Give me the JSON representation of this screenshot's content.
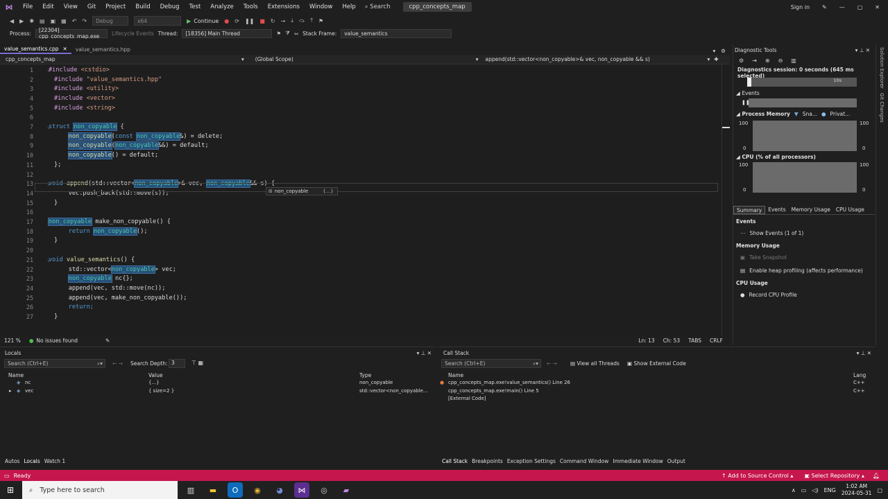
{
  "menubar": {
    "items": [
      "File",
      "Edit",
      "View",
      "Git",
      "Project",
      "Build",
      "Debug",
      "Test",
      "Analyze",
      "Tools",
      "Extensions",
      "Window",
      "Help"
    ],
    "search": "Search",
    "solution": "cpp_concepts_map",
    "signin": "Sign in"
  },
  "toolbar": {
    "config": "Debug",
    "platform": "x64",
    "continue": "Continue",
    "process_label": "Process:",
    "process_value": "[22304] cpp_concepts_map.exe",
    "lifecycle": "Lifecycle Events",
    "thread_label": "Thread:",
    "thread_value": "[18356] Main Thread",
    "stack_label": "Stack Frame:",
    "stack_value": "value_semantics"
  },
  "editor": {
    "tabs": [
      "value_semantics.cpp",
      "value_semantics.hpp"
    ],
    "nav_project": "cpp_concepts_map",
    "nav_scope": "(Global Scope)",
    "nav_member": "append(std::vector<non_copyable>& vec, non_copyable && s)",
    "tooltip": "non_copyable",
    "tooltip_extra": "{...}",
    "zoom": "121 %",
    "issues": "No issues found",
    "ln": "Ln: 13",
    "ch": "Ch: 53",
    "tabs_mode": "TABS",
    "eol": "CRLF"
  },
  "diagnostics": {
    "title": "Diagnostic Tools",
    "session": "Diagnostics session: 0 seconds (645 ms selected)",
    "timeline_tick": "10s",
    "events_label": "Events",
    "memory_label": "Process Memory",
    "snap": "Sna...",
    "private": "Privat...",
    "mem_max": "100",
    "mem_min": "0",
    "cpu_label": "CPU (% of all processors)",
    "cpu_max": "100",
    "cpu_min": "0",
    "tabs": [
      "Summary",
      "Events",
      "Memory Usage",
      "CPU Usage"
    ],
    "events_section": "Events",
    "show_events": "Show Events (1 of 1)",
    "memory_section": "Memory Usage",
    "take_snapshot": "Take Snapshot",
    "heap_profiling": "Enable heap profiling (affects performance)",
    "cpu_section": "CPU Usage",
    "record_cpu": "Record CPU Profile",
    "side_tabs": [
      "Solution Explorer",
      "Git Changes"
    ]
  },
  "locals": {
    "title": "Locals",
    "search": "Search (Ctrl+E)",
    "depth_label": "Search Depth:",
    "depth_value": "3",
    "columns": [
      "Name",
      "Value",
      "Type"
    ],
    "rows": [
      {
        "name": "nc",
        "value": "{...}",
        "type": "non_copyable"
      },
      {
        "name": "vec",
        "value": "{ size=2 }",
        "type": "std::vector<non_copyable..."
      }
    ],
    "bottom_tabs": [
      "Autos",
      "Locals",
      "Watch 1"
    ]
  },
  "callstack": {
    "title": "Call Stack",
    "search": "Search (Ctrl+E)",
    "view_threads": "View all Threads",
    "show_external": "Show External Code",
    "columns": [
      "Name",
      "Lang"
    ],
    "rows": [
      {
        "name": "cpp_concepts_map.exe!value_semantics() Line 26",
        "lang": "C++"
      },
      {
        "name": "cpp_concepts_map.exe!main() Line 5",
        "lang": "C++"
      },
      {
        "name": "[External Code]",
        "lang": ""
      }
    ],
    "bottom_tabs": [
      "Call Stack",
      "Breakpoints",
      "Exception Settings",
      "Command Window",
      "Immediate Window",
      "Output"
    ]
  },
  "statusbar": {
    "ready": "Ready",
    "source_control": "Add to Source Control",
    "repository": "Select Repository"
  },
  "taskbar": {
    "search": "Type here to search",
    "lang": "ENG",
    "time": "1:02 AM",
    "date": "2024-05-31"
  },
  "code_lines": [
    "1",
    "2",
    "3",
    "4",
    "5",
    "6",
    "7",
    "8",
    "9",
    "10",
    "11",
    "12",
    "13",
    "14",
    "15",
    "16",
    "17",
    "18",
    "19",
    "20",
    "21",
    "22",
    "23",
    "24",
    "25",
    "26",
    "27"
  ],
  "code": {
    "l1a": "#include ",
    "l1b": "<cstdio>",
    "l2a": "#include ",
    "l2b": "\"value_semantics.hpp\"",
    "l3a": "#include ",
    "l3b": "<utility>",
    "l4a": "#include ",
    "l4b": "<vector>",
    "l5a": "#include ",
    "l5b": "<string>",
    "struct": "struct",
    "nc": "non_copyable",
    "brace_open": " {",
    "const": "const",
    "amp_del": "&) = delete;",
    "ampamp_def": "&&) = default;",
    "paren_def": "() = default;",
    "close_semi": "};",
    "void": "void",
    "append": "append",
    "stdvector": "(std::vector<",
    "vec_part": ">& vec, ",
    "s_part": "&& s) {",
    "push": "vec.push_back(std::move(s));",
    "close": "}",
    "make": " make_non_copyable() {",
    "return": "return",
    "call_close": "();",
    "vs": "value_semantics",
    "vs_rest": "() {",
    "stdvec2": "std::vector<",
    "vec2": "> vec;",
    "nc_decl": " nc{};",
    "append1": "append(vec, std::move(nc));",
    "append2": "append(vec, make_non_copyable());",
    "ret": "return;",
    "lparen": "(",
    "hashinc": "#include"
  }
}
